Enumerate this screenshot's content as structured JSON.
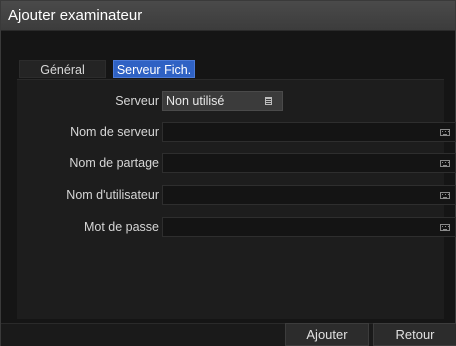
{
  "dialog": {
    "title": "Ajouter examinateur"
  },
  "tabs": [
    {
      "label": "Général",
      "active": false
    },
    {
      "label": "Serveur Fich.",
      "active": true
    }
  ],
  "form": {
    "serveur": {
      "label": "Serveur",
      "value": "Non utilisé",
      "icon": "list-icon"
    },
    "fields": [
      {
        "label": "Nom de serveur",
        "value": "",
        "icon": "keyboard-icon"
      },
      {
        "label": "Nom de partage",
        "value": "",
        "icon": "keyboard-icon"
      },
      {
        "label": "Nom d'utilisateur",
        "value": "",
        "icon": "keyboard-icon"
      },
      {
        "label": "Mot de passe",
        "value": "",
        "icon": "keyboard-icon"
      }
    ]
  },
  "buttons": {
    "add": "Ajouter",
    "back": "Retour"
  },
  "colors": {
    "accent": "#2f62c4",
    "background": "#151515",
    "titlebar": "#444444"
  }
}
